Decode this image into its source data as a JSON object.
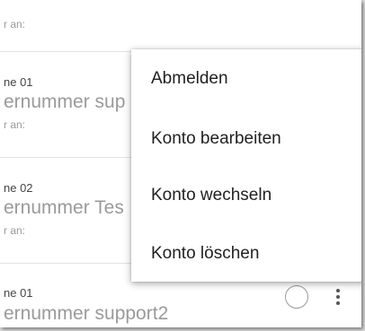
{
  "accounts": [
    {
      "line1": "r an:",
      "line2": "",
      "line3": ""
    },
    {
      "line1": "ne 01",
      "line2": "ernummer sup",
      "line3": "r an:"
    },
    {
      "line1": "ne 02",
      "line2": "ernummer Tes",
      "line3": "r an:"
    },
    {
      "line1": "ne 01",
      "line2": "ernummer support2",
      "line3": ""
    }
  ],
  "menu": {
    "items": [
      {
        "label": "Abmelden"
      },
      {
        "label": "Konto bearbeiten"
      },
      {
        "label": "Konto wechseln"
      },
      {
        "label": "Konto löschen"
      }
    ]
  },
  "icons": {
    "radio": "radio-unselected-icon",
    "more": "more-vertical-icon"
  }
}
